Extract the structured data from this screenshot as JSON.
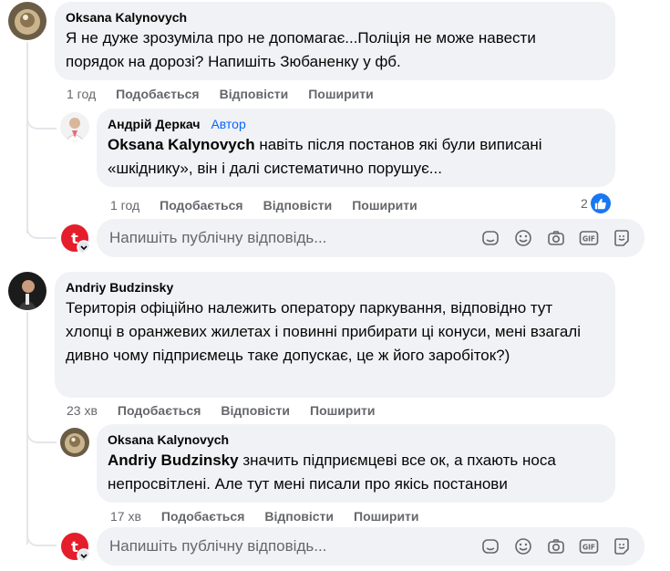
{
  "comments": [
    {
      "author": "Oksana Kalynovych",
      "text": "Я не дуже зрозуміла про не допомагає...Поліція не може навести порядок на дорозі? Напишіть Зюбаненку у фб.",
      "time": "1 год",
      "like_label": "Подобається",
      "reply_label": "Відповісти",
      "share_label": "Поширити",
      "replies": [
        {
          "author": "Андрій Деркач",
          "badge": "Автор",
          "mention": "Oksana Kalynovych",
          "text": "навіть після постанов які були виписані «шкіднику», він і далі систематично порушує...",
          "time": "1 год",
          "like_label": "Подобається",
          "reply_label": "Відповісти",
          "share_label": "Поширити",
          "reaction_count": "2"
        }
      ],
      "reply_placeholder": "Напишіть публічну відповідь..."
    },
    {
      "author": "Andriy Budzinsky",
      "text": "Територія офіційно належить оператору паркування, відповідно тут хлопці в оранжевих жилетах і повинні прибирати ці конуси, мені взагалі дивно чому підприємець таке допускає, це ж його заробіток?)",
      "time": "23 хв",
      "like_label": "Подобається",
      "reply_label": "Відповісти",
      "share_label": "Поширити",
      "replies": [
        {
          "author": "Oksana Kalynovych",
          "mention": "Andriy Budzinsky",
          "text": "значить підприємцеві все ок, а пхають носа непросвітлені. Але тут мені писали про якісь постанови",
          "time": "17 хв",
          "like_label": "Подобається",
          "reply_label": "Відповісти",
          "share_label": "Поширити"
        }
      ],
      "reply_placeholder": "Напишіть публічну відповідь..."
    }
  ],
  "icons": [
    "sticker-icon",
    "emoji-icon",
    "camera-icon",
    "gif-icon",
    "avatar-sticker-icon"
  ],
  "colors": {
    "bubble": "#f0f2f5",
    "meta": "#65676b",
    "author_badge": "#0866ff",
    "like_blue": "#1877f2",
    "brand_red": "#e41e2b"
  }
}
